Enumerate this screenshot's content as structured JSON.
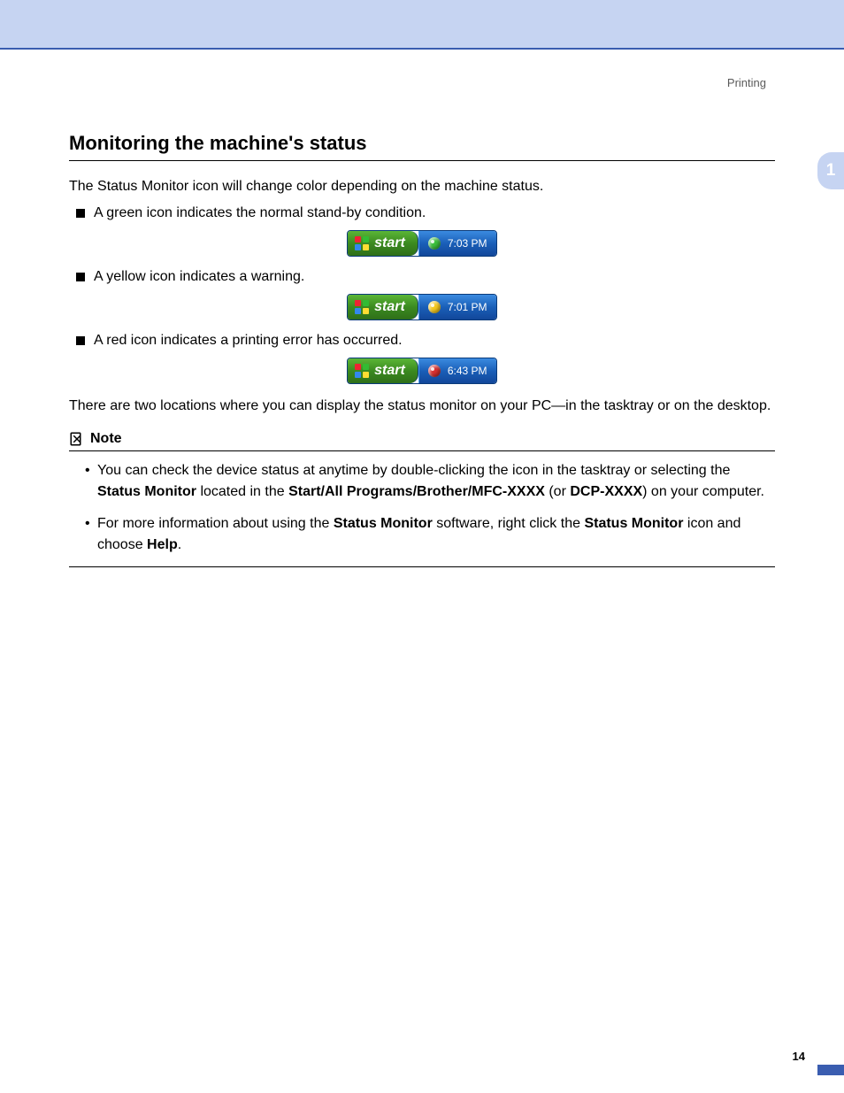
{
  "header": {
    "section_link": "Printing"
  },
  "chapter_tab": "1",
  "page_number": "14",
  "title": "Monitoring the machine's status",
  "intro": "The Status Monitor icon will change color depending on the machine status.",
  "items": [
    {
      "text": "A green icon indicates the normal stand-by condition.",
      "time": "7:03 PM",
      "dot": "green"
    },
    {
      "text": "A yellow icon indicates a warning.",
      "time": "7:01 PM",
      "dot": "yellow"
    },
    {
      "text": "A red icon indicates a printing error has occurred.",
      "time": "6:43 PM",
      "dot": "red"
    }
  ],
  "start_label": "start",
  "outro": "There are two locations where you can display the status monitor on your PC—in the tasktray or on the desktop.",
  "note": {
    "label": "Note",
    "bullets_html": [
      "You can check the device status at anytime by double-clicking the icon in the tasktray or selecting the <b>Status Monitor</b> located in the <b>Start/All Programs/Brother/MFC-XXXX</b> (or <b>DCP-XXXX</b>) on your computer.",
      "For more information about using the <b>Status Monitor</b> software, right click the <b>Status Monitor</b> icon and choose <b>Help</b>."
    ]
  }
}
